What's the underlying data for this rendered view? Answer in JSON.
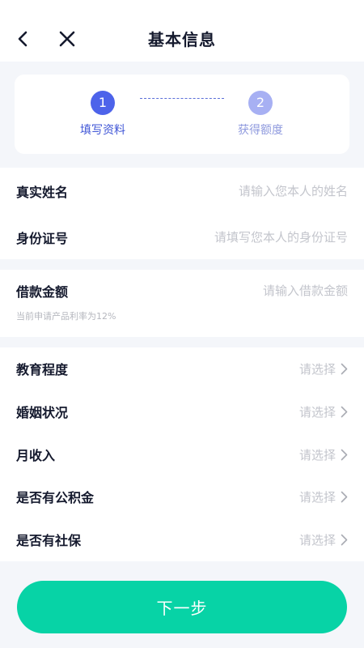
{
  "header": {
    "title": "基本信息"
  },
  "steps": [
    {
      "number": "1",
      "label": "填写资料"
    },
    {
      "number": "2",
      "label": "获得额度"
    }
  ],
  "identity": {
    "name_label": "真实姓名",
    "name_placeholder": "请输入您本人的姓名",
    "id_label": "身份证号",
    "id_placeholder": "请填写您本人的身份证号"
  },
  "loan": {
    "label": "借款金额",
    "placeholder": "请输入借款金额",
    "hint": "当前申请产品利率为12%"
  },
  "profile": {
    "select_placeholder": "请选择",
    "items": [
      {
        "label": "教育程度"
      },
      {
        "label": "婚姻状况"
      },
      {
        "label": "月收入"
      },
      {
        "label": "是否有公积金"
      },
      {
        "label": "是否有社保"
      }
    ]
  },
  "actions": {
    "next_label": "下一步"
  },
  "colors": {
    "accent": "#4d63ea",
    "accent_light": "#a7b0f3",
    "button": "#07d3a6",
    "background": "#f4f6fa"
  }
}
